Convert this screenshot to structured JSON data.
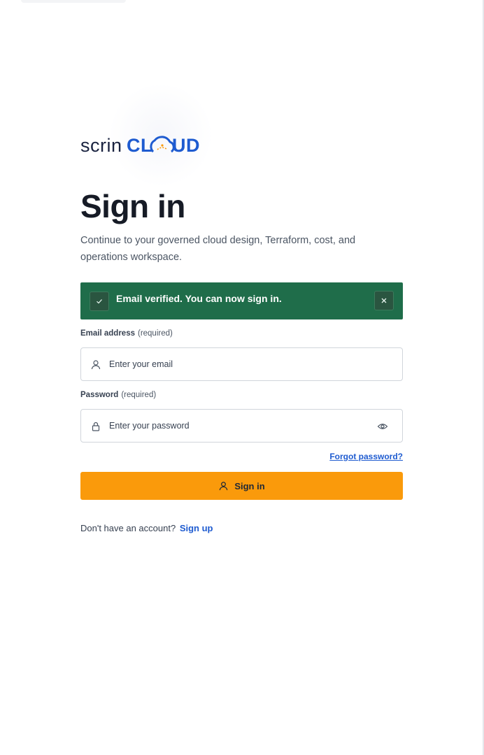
{
  "brand": {
    "logo_text": "scrinCLOUD",
    "logo_colors": {
      "scrin": "#1a2340",
      "cloud": "#1e5bd0",
      "accent": "#fa9a0b"
    }
  },
  "header": {
    "title": "Sign in",
    "subtitle": "Continue to your governed cloud design, Terraform, cost, and operations workspace."
  },
  "alert": {
    "type": "success",
    "message": "Email verified. You can now sign in.",
    "icon": "check-icon",
    "close_icon": "close-icon",
    "color": "#1f6d4a"
  },
  "form": {
    "email": {
      "label": "Email address",
      "required_text": "(required)",
      "placeholder": "Enter your email",
      "value": "",
      "icon": "user-icon"
    },
    "password": {
      "label": "Password",
      "required_text": "(required)",
      "placeholder": "Enter your password",
      "value": "",
      "icon": "lock-icon",
      "toggle_icon": "eye-icon"
    },
    "forgot_label": "Forgot password?",
    "submit_label": "Sign in",
    "submit_icon": "user-icon",
    "submit_color": "#fa9a0b"
  },
  "footer": {
    "prompt": "Don't have an account?",
    "signup_label": "Sign up"
  }
}
